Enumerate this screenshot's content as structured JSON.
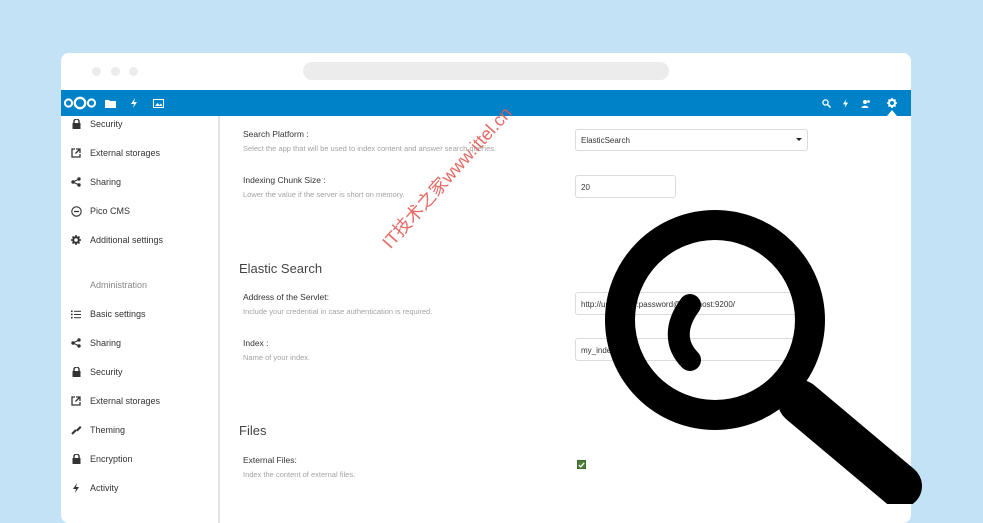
{
  "colors": {
    "background": "#c4e2f5",
    "header": "#0082c9",
    "checkbox": "#4c7f3a",
    "watermark": "#e35a55"
  },
  "header": {
    "icons": [
      "nextcloud-logo",
      "files-icon",
      "activity-icon",
      "gallery-icon",
      "search-icon",
      "notifications-icon",
      "contacts-icon",
      "settings-gear-icon"
    ]
  },
  "sidebar": {
    "personal_items": [
      {
        "label": "Security",
        "icon": "lock-icon"
      },
      {
        "label": "External storages",
        "icon": "external-link-icon"
      },
      {
        "label": "Sharing",
        "icon": "share-icon"
      },
      {
        "label": "Pico CMS",
        "icon": "pico-cms-icon"
      },
      {
        "label": "Additional settings",
        "icon": "gear-icon"
      }
    ],
    "admin_heading": "Administration",
    "admin_items": [
      {
        "label": "Basic settings",
        "icon": "list-icon"
      },
      {
        "label": "Sharing",
        "icon": "share-icon"
      },
      {
        "label": "Security",
        "icon": "lock-icon"
      },
      {
        "label": "External storages",
        "icon": "external-link-icon"
      },
      {
        "label": "Theming",
        "icon": "paint-icon"
      },
      {
        "label": "Encryption",
        "icon": "lock-icon"
      },
      {
        "label": "Activity",
        "icon": "activity-icon"
      }
    ]
  },
  "main": {
    "search_platform": {
      "label": "Search Platform :",
      "hint": "Select the app that will be used to index content and answer search queries.",
      "value": "ElasticSearch"
    },
    "chunk_size": {
      "label": "Indexing Chunk Size :",
      "hint": "Lower the value if the server is short on memory.",
      "value": "20"
    },
    "elastic_heading": "Elastic Search",
    "servlet": {
      "label": "Address of the Servlet:",
      "hint": "Include your credential in case authentication is required.",
      "value": "http://username:password@localhost:9200/"
    },
    "index": {
      "label": "Index :",
      "hint": "Name of your index.",
      "value": "my_index"
    },
    "files_heading": "Files",
    "external_files": {
      "label": "External Files:",
      "hint": "Index the content of external files.",
      "checked": true
    }
  },
  "watermark": "IT技术之家www.ittel.cn"
}
